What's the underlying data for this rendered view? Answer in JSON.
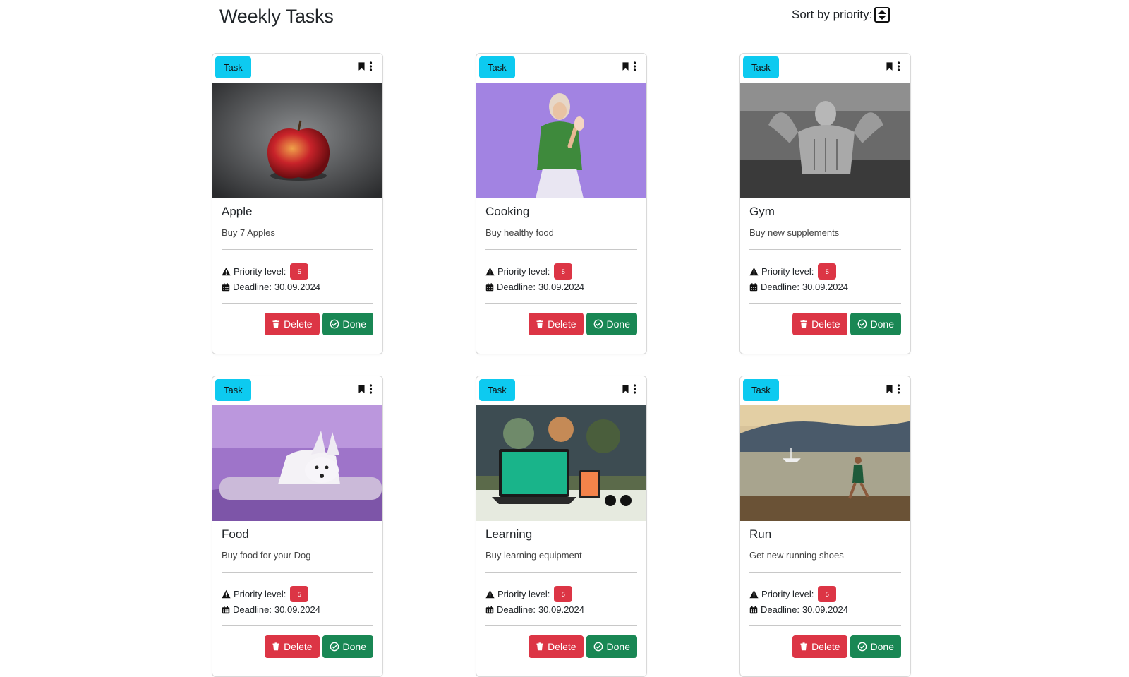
{
  "header": {
    "title": "Weekly Tasks",
    "sort_label": "Sort by priority:",
    "sort_icon": "sort-updown-icon"
  },
  "labels": {
    "type_badge": "Task",
    "priority_label": "Priority level:",
    "deadline_prefix": "Deadline:",
    "delete": "Delete",
    "done": "Done"
  },
  "colors": {
    "type_badge": "#0dcaf0",
    "priority_badge": "#dc3545",
    "delete_button": "#dc3545",
    "done_button": "#198754"
  },
  "tasks": [
    {
      "title": "Apple",
      "description": "Buy 7 Apples",
      "priority": "5",
      "deadline": "30.09.2024",
      "image": "red-apple-photo"
    },
    {
      "title": "Cooking",
      "description": "Buy healthy food",
      "priority": "5",
      "deadline": "30.09.2024",
      "image": "woman-with-spoon-photo"
    },
    {
      "title": "Gym",
      "description": "Buy new supplements",
      "priority": "5",
      "deadline": "30.09.2024",
      "image": "bodybuilder-photo"
    },
    {
      "title": "Food",
      "description": "Buy food for your Dog",
      "priority": "5",
      "deadline": "30.09.2024",
      "image": "white-dog-photo"
    },
    {
      "title": "Learning",
      "description": "Buy learning equipment",
      "priority": "5",
      "deadline": "30.09.2024",
      "image": "laptop-learning-photo"
    },
    {
      "title": "Run",
      "description": "Get new running shoes",
      "priority": "5",
      "deadline": "30.09.2024",
      "image": "runner-beach-photo"
    }
  ]
}
